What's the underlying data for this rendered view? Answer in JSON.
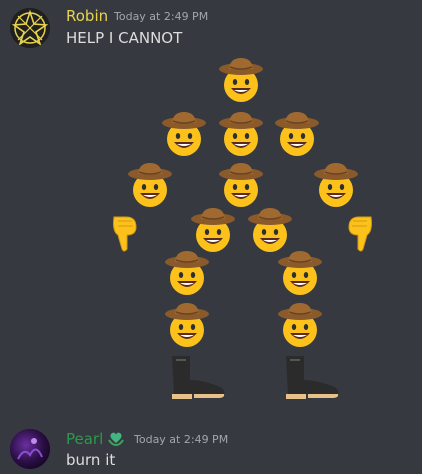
{
  "messages": [
    {
      "username": "Robin",
      "username_color": "#e8d44d",
      "timestamp": "Today at 2:49 PM",
      "text": "HELP I CANNOT",
      "emoji_art": {
        "cowboy_emoji": "cowboy-hat-face",
        "left_pointer": "backhand-index-pointing-down",
        "right_pointer": "backhand-index-pointing-down",
        "boots": "womans-boot"
      }
    },
    {
      "username": "Pearl",
      "username_color": "#2b9a4b",
      "timestamp": "Today at 2:49 PM",
      "text": "burn it",
      "badge_icon": "green-heart-hands-icon"
    }
  ],
  "colors": {
    "background": "#36393f",
    "text": "#dcddde",
    "muted": "#a3a6aa"
  }
}
